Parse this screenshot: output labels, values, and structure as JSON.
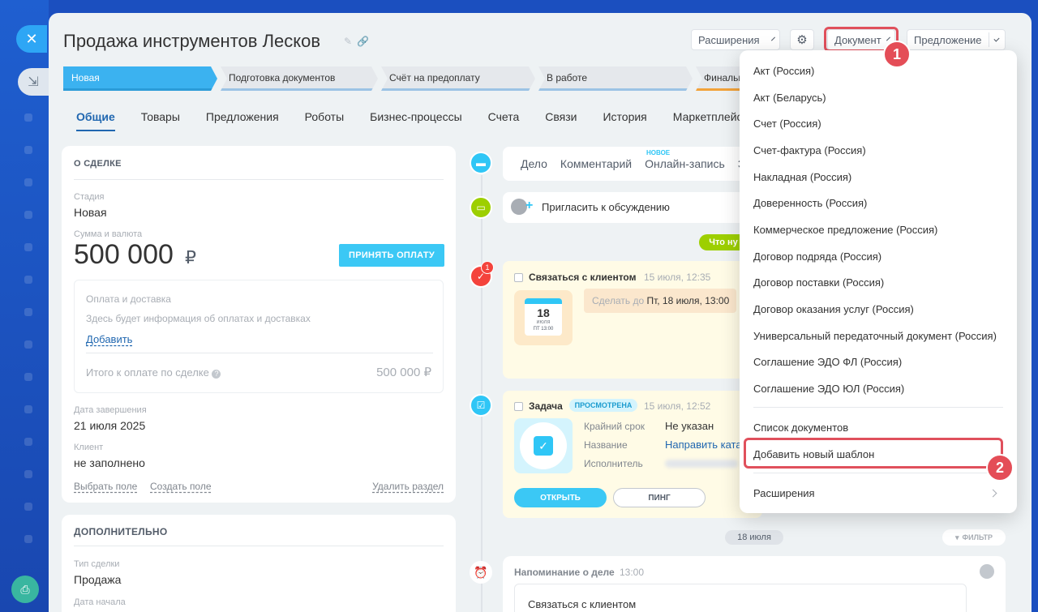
{
  "header": {
    "title": "Продажа инструментов Лесков",
    "ext_button": "Расширения",
    "doc_button": "Документ",
    "offer_button": "Предложение"
  },
  "stages": [
    "Новая",
    "Подготовка документов",
    "Счёт на предоплату",
    "В работе",
    "Финальн"
  ],
  "tabs": [
    "Общие",
    "Товары",
    "Предложения",
    "Роботы",
    "Бизнес-процессы",
    "Счета",
    "Связи",
    "История",
    "Маркетплейс"
  ],
  "about": {
    "section_title": "О СДЕЛКЕ",
    "stage_label": "Стадия",
    "stage_value": "Новая",
    "sum_label": "Сумма и валюта",
    "sum_value": "500 000",
    "currency": "₽",
    "accept_button": "ПРИНЯТЬ ОПЛАТУ",
    "payment_title": "Оплата и доставка",
    "payment_hint": "Здесь будет информация об оплатах и доставках",
    "add_link": "Добавить",
    "total_label": "Итого к оплате по сделке",
    "total_value": "500 000 ₽",
    "end_date_label": "Дата завершения",
    "end_date_value": "21 июля 2025",
    "client_label": "Клиент",
    "client_value": "не заполнено",
    "choose_field": "Выбрать поле",
    "create_field": "Создать поле",
    "delete_section": "Удалить раздел"
  },
  "additional": {
    "section_title": "ДОПОЛНИТЕЛЬНО",
    "type_label": "Тип сделки",
    "type_value": "Продажа",
    "start_label": "Дата начала"
  },
  "activity": {
    "tabs": [
      "Дело",
      "Комментарий",
      "Онлайн-запись",
      "З"
    ],
    "new_label": "НОВОЕ",
    "invite": "Пригласить к обсуждению",
    "whats_new": "Что ну"
  },
  "task1": {
    "title": "Связаться с клиентом",
    "date": "15 июля, 12:35",
    "counter": "1",
    "due_prefix": "Сделать до",
    "due_value": "Пт, 18 июля, 13:00",
    "cal_day": "18",
    "cal_month": "июля",
    "cal_time": "ПТ 13:00"
  },
  "task2": {
    "title": "Задача",
    "status": "ПРОСМОТРЕНА",
    "date": "15 июля, 12:52",
    "deadline_label": "Крайний срок",
    "deadline_value": "Не указан",
    "name_label": "Название",
    "name_value": "Направить ката",
    "exec_label": "Исполнитель",
    "open_button": "ОТКРЫТЬ",
    "ping_button": "ПИНГ"
  },
  "timeline": {
    "date_divider": "18 июля",
    "filter": "ФИЛЬТР",
    "reminder_title": "Напоминание о деле",
    "reminder_time": "13:00",
    "reminder_text": "Связаться с клиентом"
  },
  "menu": {
    "items": [
      "Акт (Россия)",
      "Акт (Беларусь)",
      "Счет (Россия)",
      "Счет-фактура (Россия)",
      "Накладная (Россия)",
      "Доверенность (Россия)",
      "Коммерческое предложение (Россия)",
      "Договор подряда (Россия)",
      "Договор поставки (Россия)",
      "Договор оказания услуг (Россия)",
      "Универсальный передаточный документ (Россия)",
      "Соглашение ЭДО ФЛ (Россия)",
      "Соглашение ЭДО ЮЛ (Россия)"
    ],
    "doc_list": "Список документов",
    "add_template": "Добавить новый шаблон",
    "extensions": "Расширения"
  },
  "callouts": {
    "one": "1",
    "two": "2"
  },
  "colors": {
    "accent": "#3bc8f5",
    "highlight": "#e0505c",
    "brand": "#2067b0"
  }
}
